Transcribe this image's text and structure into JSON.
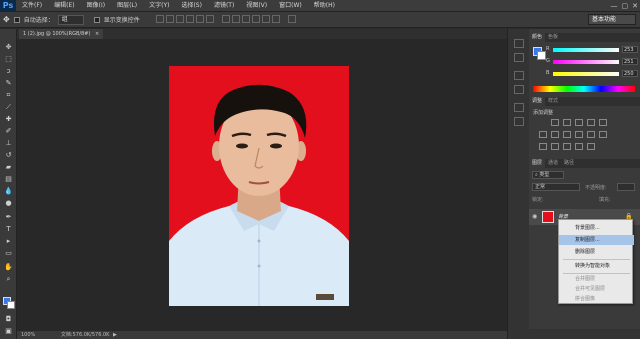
{
  "app": {
    "logo": "Ps"
  },
  "menu": [
    "文件(F)",
    "编辑(E)",
    "图像(I)",
    "图层(L)",
    "文字(Y)",
    "选择(S)",
    "滤镜(T)",
    "视图(V)",
    "窗口(W)",
    "帮助(H)"
  ],
  "window_controls": {
    "minimize": "—",
    "maximize": "▢",
    "close": "✕"
  },
  "options": {
    "auto_select_label": "自动选择：",
    "auto_select_value": "组",
    "show_transform_label": "显示变换控件",
    "workspace": "基本功能"
  },
  "document": {
    "tab_title": "1 (2).jpg @ 100%(RGB/8#)",
    "tab_close": "×",
    "zoom": "100%",
    "doc_info": "文档:576.0K/576.0K"
  },
  "color_panel": {
    "tabs": [
      "颜色",
      "色板"
    ],
    "channels": [
      {
        "label": "R",
        "value": "253"
      },
      {
        "label": "G",
        "value": "251"
      },
      {
        "label": "B",
        "value": "250"
      }
    ],
    "fg_color": "#3b78e7"
  },
  "adjust_panel": {
    "tabs": [
      "调整",
      "样式"
    ],
    "title": "添加调整"
  },
  "layers_panel": {
    "tabs": [
      "图层",
      "通道",
      "路径"
    ],
    "filter": "类型",
    "blend_mode": "正常",
    "opacity_label": "不透明度:",
    "lock_label": "锁定:",
    "fill_label": "填充:",
    "layer_name": "背景"
  },
  "context_menu": {
    "items": [
      {
        "label": "背景图层...",
        "disabled": false,
        "highlight": false
      },
      {
        "label": "复制图层...",
        "disabled": false,
        "highlight": true
      },
      {
        "label": "删除图层",
        "disabled": false,
        "highlight": false
      },
      {
        "label": "转换为智能对象",
        "disabled": false,
        "highlight": false
      },
      {
        "label": "合并图层",
        "disabled": true,
        "highlight": false
      },
      {
        "label": "合并可见图层",
        "disabled": true,
        "highlight": false
      },
      {
        "label": "拼合图像",
        "disabled": true,
        "highlight": false
      }
    ]
  },
  "colors": {
    "photo_bg": "#e30f1c",
    "highlight": "#a6c4ea",
    "accent": "#3b78e7"
  },
  "tools": [
    "move-tool-icon",
    "marquee-tool-icon",
    "lasso-tool-icon",
    "quick-select-tool-icon",
    "crop-tool-icon",
    "eyedropper-tool-icon",
    "healing-brush-icon",
    "brush-tool-icon",
    "clone-stamp-icon",
    "history-brush-icon",
    "eraser-tool-icon",
    "gradient-tool-icon",
    "blur-tool-icon",
    "dodge-tool-icon",
    "pen-tool-icon",
    "type-tool-icon",
    "path-select-icon",
    "shape-tool-icon",
    "hand-tool-icon",
    "zoom-tool-icon"
  ]
}
